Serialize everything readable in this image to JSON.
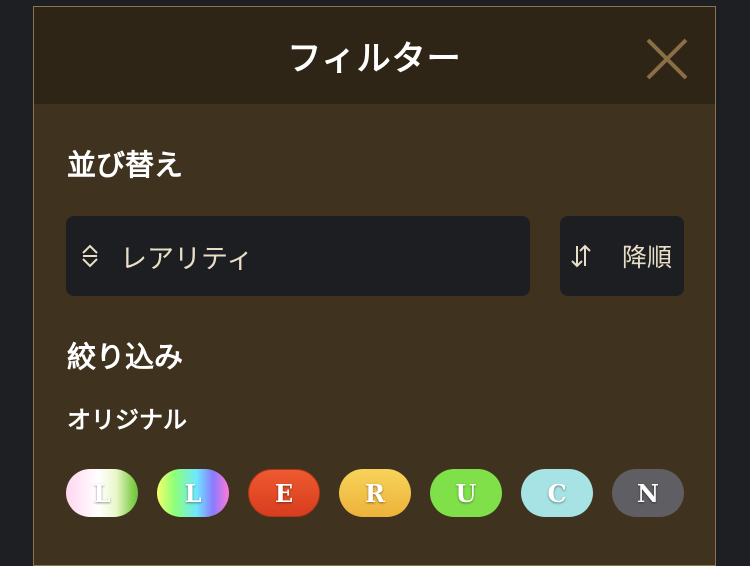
{
  "header": {
    "title": "フィルター"
  },
  "sort": {
    "section_title": "並び替え",
    "selected": "レアリティ",
    "order_label": "降順"
  },
  "filter": {
    "section_title": "絞り込み",
    "group_title": "オリジナル",
    "chips": [
      {
        "label": "L",
        "name": "rarity-chip-l-pastel"
      },
      {
        "label": "L",
        "name": "rarity-chip-l-rainbow"
      },
      {
        "label": "E",
        "name": "rarity-chip-e"
      },
      {
        "label": "R",
        "name": "rarity-chip-r"
      },
      {
        "label": "U",
        "name": "rarity-chip-u"
      },
      {
        "label": "C",
        "name": "rarity-chip-c"
      },
      {
        "label": "N",
        "name": "rarity-chip-n"
      }
    ]
  },
  "colors": {
    "modal_bg": "#3f331f",
    "header_bg": "#2f2516",
    "border": "#8a7350",
    "field_bg": "#1c1e22",
    "chip_e": "#e24a26",
    "chip_r": "#f2c24a",
    "chip_u": "#7fe04a",
    "chip_c": "#a7e3e4",
    "chip_n": "#5f5f63"
  }
}
